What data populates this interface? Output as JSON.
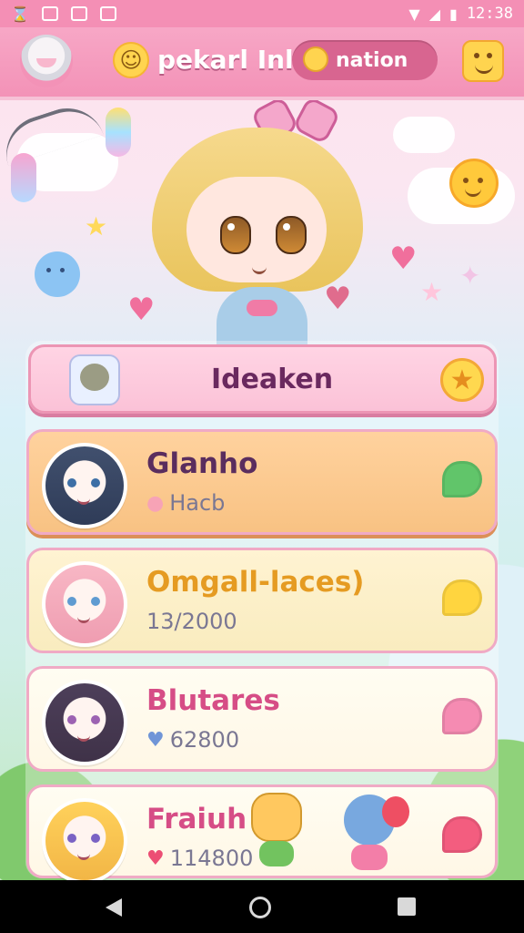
{
  "status_bar": {
    "time": "12:38"
  },
  "header": {
    "title": "pekarl Inlan",
    "mode_label": "nation"
  },
  "main": {
    "title_card": {
      "label": "Ideaken"
    },
    "items": [
      {
        "name": "Glanho",
        "subtitle": "Hacb"
      },
      {
        "name": "Omgall-laces)",
        "subtitle": "13/2000"
      },
      {
        "name": "Blutares",
        "subtitle": "62800"
      },
      {
        "name": "Fraiuh",
        "subtitle": "114800"
      }
    ]
  },
  "icons": {
    "header_left": "avatar-icon",
    "header_center": "smile-icon",
    "header_pill": "mode-icon",
    "header_right": "happy-face-icon",
    "title_card_right": "star-icon",
    "item_bubbles": [
      "green-bubble-icon",
      "yellow-bubble-icon",
      "pink-bubble-icon",
      "red-bubble-icon"
    ]
  },
  "colors": {
    "header_bg": "#f392b7",
    "title_card_bg": "#fbc2d7",
    "accent_text": "#d64d86",
    "gold_text": "#e59b22"
  }
}
